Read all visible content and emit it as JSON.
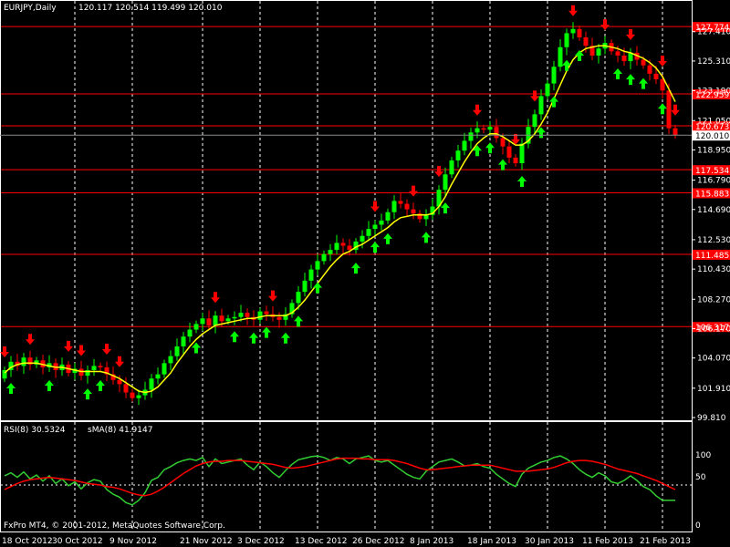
{
  "header": {
    "symbol_period": "EURJPY,Daily",
    "ohlc": "120.117 120.514 119.499 120.010"
  },
  "indicator_header": {
    "rsi_label": "RSI(8) 30.5324",
    "ma_label": "sMA(8) 41.9147"
  },
  "footer": {
    "copyright": "FxPro MT4, © 2001-2012, MetaQuotes Software Corp."
  },
  "price_axis": {
    "ticks": [
      "127.410",
      "125.310",
      "123.190",
      "121.050",
      "118.950",
      "116.790",
      "114.690",
      "112.530",
      "110.430",
      "108.270",
      "106.170",
      "104.070",
      "101.910",
      "99.810"
    ],
    "current_price": "120.010"
  },
  "levels": {
    "values": [
      "127.774",
      "122.959",
      "120.673",
      "117.534",
      "115.883",
      "111.485",
      "106.317"
    ],
    "line_color": "#ff0000"
  },
  "rsi_axis": {
    "ticks": [
      "100",
      "50",
      "0"
    ]
  },
  "time_axis": {
    "labels": [
      "18 Oct 2012",
      "30 Oct 2012",
      "9 Nov 2012",
      "21 Nov 2012",
      "3 Dec 2012",
      "13 Dec 2012",
      "26 Dec 2012",
      "8 Jan 2013",
      "18 Jan 2013",
      "30 Jan 2013",
      "11 Feb 2013",
      "21 Feb 2013"
    ]
  },
  "colors": {
    "background": "#000000",
    "bull_candle": "#00ff00",
    "bear_candle": "#ff0000",
    "moving_average": "#ffff00",
    "rsi_line": "#32cd32",
    "rsi_ma": "#ff0000",
    "up_arrow": "#00ff00",
    "down_arrow": "#ff0000"
  },
  "chart_data": {
    "type": "candlestick",
    "closes": [
      103.2,
      103.8,
      103.5,
      104.1,
      103.6,
      103.9,
      103.4,
      103.7,
      103.2,
      103.6,
      103.0,
      103.3,
      102.8,
      103.2,
      103.5,
      103.4,
      102.9,
      102.5,
      102.2,
      101.6,
      101.2,
      101.4,
      101.8,
      102.6,
      102.9,
      103.7,
      104.2,
      104.9,
      105.6,
      106.1,
      106.5,
      106.9,
      106.4,
      107.1,
      106.7,
      106.9,
      107.0,
      107.3,
      107.0,
      106.8,
      107.4,
      107.2,
      107.0,
      106.8,
      107.2,
      108.0,
      108.8,
      109.6,
      110.4,
      111.0,
      111.5,
      111.8,
      112.3,
      112.1,
      111.8,
      112.4,
      112.8,
      113.3,
      113.6,
      113.9,
      114.5,
      115.3,
      115.1,
      114.7,
      114.4,
      114.0,
      114.3,
      114.9,
      116.1,
      117.2,
      118.2,
      118.9,
      119.6,
      120.2,
      120.5,
      120.4,
      120.6,
      119.8,
      119.2,
      118.4,
      118.0,
      119.4,
      120.6,
      121.5,
      122.8,
      123.7,
      124.9,
      126.3,
      127.3,
      127.6,
      127.0,
      126.4,
      125.7,
      126.2,
      126.6,
      126.0,
      125.7,
      125.3,
      125.9,
      125.4,
      125.0,
      124.4,
      124.0,
      123.2,
      120.5,
      120.0
    ],
    "ma_values": [
      103.0,
      103.4,
      103.6,
      103.7,
      103.7,
      103.7,
      103.6,
      103.5,
      103.4,
      103.4,
      103.3,
      103.2,
      103.1,
      103.1,
      103.1,
      103.1,
      103.0,
      102.8,
      102.6,
      102.3,
      102.0,
      101.7,
      101.6,
      101.7,
      102.0,
      102.5,
      103.0,
      103.7,
      104.3,
      104.9,
      105.4,
      105.8,
      106.1,
      106.4,
      106.5,
      106.6,
      106.7,
      106.8,
      106.9,
      106.9,
      107.0,
      107.1,
      107.1,
      107.1,
      107.1,
      107.3,
      107.7,
      108.2,
      108.8,
      109.4,
      110.0,
      110.6,
      111.1,
      111.5,
      111.7,
      112.0,
      112.2,
      112.5,
      112.8,
      113.1,
      113.4,
      113.8,
      114.1,
      114.2,
      114.3,
      114.3,
      114.3,
      114.4,
      114.9,
      115.6,
      116.5,
      117.3,
      118.1,
      118.8,
      119.4,
      119.8,
      120.1,
      120.1,
      119.9,
      119.6,
      119.3,
      119.3,
      119.6,
      120.1,
      120.8,
      121.6,
      122.6,
      123.6,
      124.6,
      125.4,
      125.9,
      126.2,
      126.3,
      126.4,
      126.4,
      126.3,
      126.2,
      126.0,
      125.9,
      125.7,
      125.5,
      125.2,
      124.8,
      124.2,
      123.3,
      122.4
    ],
    "rsi_values": [
      62,
      66,
      60,
      67,
      58,
      63,
      55,
      62,
      52,
      58,
      49,
      54,
      45,
      53,
      57,
      55,
      44,
      38,
      34,
      27,
      24,
      30,
      40,
      56,
      60,
      70,
      74,
      79,
      82,
      84,
      82,
      86,
      74,
      84,
      78,
      80,
      82,
      84,
      76,
      70,
      80,
      74,
      66,
      60,
      69,
      77,
      83,
      85,
      87,
      88,
      86,
      82,
      86,
      84,
      78,
      84,
      86,
      88,
      82,
      80,
      82,
      76,
      70,
      64,
      60,
      58,
      68,
      74,
      80,
      82,
      84,
      80,
      75,
      76,
      78,
      74,
      72,
      64,
      58,
      52,
      48,
      64,
      72,
      76,
      80,
      82,
      86,
      88,
      84,
      78,
      70,
      64,
      60,
      66,
      62,
      54,
      52,
      56,
      62,
      56,
      48,
      44,
      36,
      30,
      30,
      30
    ],
    "rsi_ma_values": [
      44,
      48,
      52,
      55,
      57,
      58,
      59,
      60,
      59,
      58,
      57,
      56,
      54,
      52,
      51,
      50,
      48,
      47,
      45,
      42,
      39,
      37,
      36,
      38,
      42,
      47,
      53,
      59,
      65,
      70,
      75,
      78,
      80,
      81,
      81,
      82,
      82,
      82,
      81,
      80,
      79,
      78,
      77,
      75,
      73,
      72,
      73,
      74,
      76,
      78,
      80,
      82,
      84,
      85,
      85,
      85,
      84,
      84,
      83,
      83,
      83,
      82,
      80,
      78,
      75,
      72,
      70,
      70,
      71,
      72,
      73,
      74,
      75,
      76,
      76,
      76,
      76,
      74,
      72,
      70,
      68,
      68,
      68,
      69,
      70,
      71,
      73,
      76,
      79,
      81,
      82,
      82,
      81,
      79,
      77,
      74,
      71,
      69,
      67,
      65,
      62,
      59,
      56,
      52,
      48,
      44
    ],
    "up_arrow_indices": [
      1,
      7,
      13,
      15,
      30,
      36,
      39,
      41,
      44,
      46,
      49,
      55,
      58,
      60,
      66,
      69,
      74,
      76,
      78,
      81,
      84,
      86,
      88,
      90,
      96,
      98,
      100,
      103
    ],
    "down_arrow_indices": [
      0,
      4,
      10,
      12,
      16,
      18,
      33,
      42,
      58,
      64,
      68,
      74,
      80,
      83,
      89,
      94,
      98,
      103,
      105
    ],
    "price_range": [
      99.81,
      128.5
    ],
    "rsi_range": [
      0,
      100
    ],
    "rsi_levels": [
      50
    ]
  }
}
